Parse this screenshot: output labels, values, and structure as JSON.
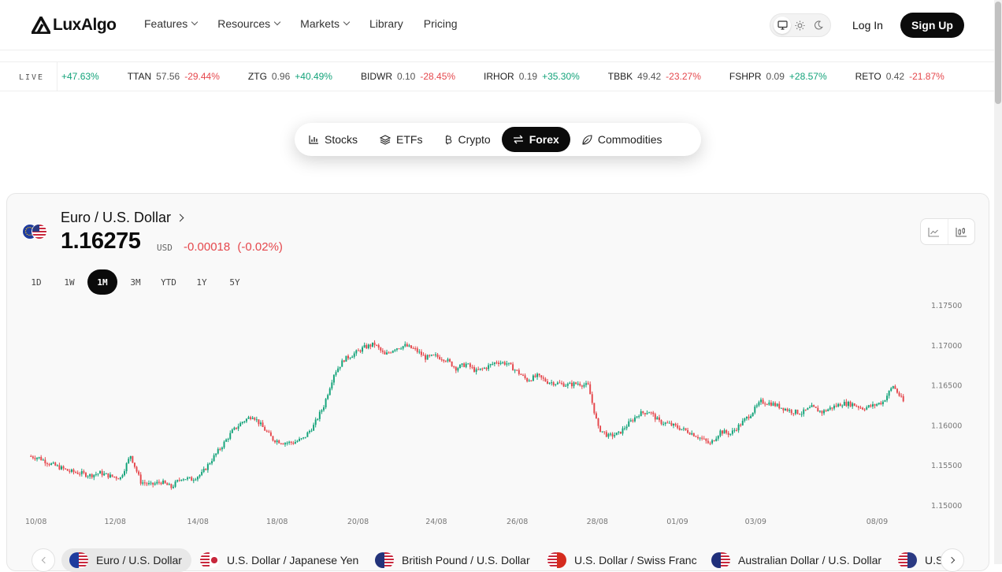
{
  "brand": {
    "name": "LuxAlgo"
  },
  "nav": {
    "links": [
      {
        "label": "Features",
        "dropdown": true
      },
      {
        "label": "Resources",
        "dropdown": true
      },
      {
        "label": "Markets",
        "dropdown": true
      },
      {
        "label": "Library",
        "dropdown": false
      },
      {
        "label": "Pricing",
        "dropdown": false
      }
    ],
    "login_label": "Log In",
    "signup_label": "Sign Up",
    "theme_options": [
      "monitor-icon",
      "sun-icon",
      "moon-icon"
    ]
  },
  "ticker": {
    "live_label": "LIVE",
    "items": [
      {
        "symbol": "",
        "price": "",
        "change": "+47.63%",
        "direction": "up"
      },
      {
        "symbol": "TTAN",
        "price": "57.56",
        "change": "-29.44%",
        "direction": "down"
      },
      {
        "symbol": "ZTG",
        "price": "0.96",
        "change": "+40.49%",
        "direction": "up"
      },
      {
        "symbol": "BIDWR",
        "price": "0.10",
        "change": "-28.45%",
        "direction": "down"
      },
      {
        "symbol": "IRHOR",
        "price": "0.19",
        "change": "+35.30%",
        "direction": "up"
      },
      {
        "symbol": "TBBK",
        "price": "49.42",
        "change": "-23.27%",
        "direction": "down"
      },
      {
        "symbol": "FSHPR",
        "price": "0.09",
        "change": "+28.57%",
        "direction": "up"
      },
      {
        "symbol": "RETO",
        "price": "0.42",
        "change": "-21.87%",
        "direction": "down"
      }
    ]
  },
  "market_tabs": [
    {
      "label": "Stocks",
      "icon": "bar-chart-icon",
      "active": false
    },
    {
      "label": "ETFs",
      "icon": "layers-icon",
      "active": false
    },
    {
      "label": "Crypto",
      "icon": "bitcoin-icon",
      "active": false
    },
    {
      "label": "Forex",
      "icon": "arrows-exchange-icon",
      "active": true
    },
    {
      "label": "Commodities",
      "icon": "leaf-icon",
      "active": false
    }
  ],
  "instrument": {
    "name": "Euro / U.S. Dollar",
    "price": "1.16275",
    "currency": "USD",
    "change": "-0.00018",
    "change_pct": "(-0.02%)"
  },
  "ranges": [
    {
      "label": "1D",
      "active": false
    },
    {
      "label": "1W",
      "active": false
    },
    {
      "label": "1M",
      "active": true
    },
    {
      "label": "3M",
      "active": false
    },
    {
      "label": "YTD",
      "active": false
    },
    {
      "label": "1Y",
      "active": false
    },
    {
      "label": "5Y",
      "active": false
    }
  ],
  "colors": {
    "up": "#13a37a",
    "down": "#e5484d",
    "accent": "#0b0b0b"
  },
  "chart_data": {
    "type": "candlestick",
    "title": "",
    "xlabel": "",
    "ylabel": "",
    "x_ticks": [
      "10/08",
      "12/08",
      "14/08",
      "18/08",
      "20/08",
      "24/08",
      "26/08",
      "28/08",
      "01/09",
      "03/09",
      "08/09"
    ],
    "y_ticks": [
      "1.17500",
      "1.17000",
      "1.16500",
      "1.16000",
      "1.15500",
      "1.15000"
    ],
    "ylim": [
      1.15,
      1.175
    ],
    "grid": false,
    "close_path": [
      1.1562,
      1.156,
      1.1553,
      1.1548,
      1.1543,
      1.1541,
      1.1538,
      1.1541,
      1.1537,
      1.1535,
      1.1563,
      1.153,
      1.1526,
      1.153,
      1.1523,
      1.1535,
      1.1533,
      1.154,
      1.1558,
      1.1575,
      1.1593,
      1.1605,
      1.1613,
      1.1598,
      1.1583,
      1.1579,
      1.1579,
      1.1584,
      1.16,
      1.1625,
      1.1665,
      1.1683,
      1.169,
      1.1698,
      1.1702,
      1.1688,
      1.1697,
      1.17,
      1.1695,
      1.1685,
      1.1687,
      1.1683,
      1.1672,
      1.1677,
      1.1668,
      1.1673,
      1.168,
      1.1678,
      1.1668,
      1.1657,
      1.1662,
      1.1655,
      1.1653,
      1.1651,
      1.1653,
      1.165,
      1.1597,
      1.1587,
      1.159,
      1.1603,
      1.1615,
      1.1618,
      1.1605,
      1.1602,
      1.1597,
      1.1592,
      1.1585,
      1.1577,
      1.1593,
      1.159,
      1.1602,
      1.1615,
      1.163,
      1.1628,
      1.1623,
      1.1618,
      1.1616,
      1.1623,
      1.1617,
      1.1623,
      1.1628,
      1.1627,
      1.1622,
      1.1625,
      1.163,
      1.165,
      1.163
    ]
  },
  "pair_selector": {
    "items": [
      {
        "label": "Euro / U.S. Dollar",
        "active": true,
        "flag": "eu-us-flag"
      },
      {
        "label": "U.S. Dollar / Japanese Yen",
        "active": false,
        "flag": "us-jp-flag"
      },
      {
        "label": "British Pound / U.S. Dollar",
        "active": false,
        "flag": "gb-us-flag"
      },
      {
        "label": "U.S. Dollar / Swiss Franc",
        "active": false,
        "flag": "us-ch-flag"
      },
      {
        "label": "Australian Dollar / U.S. Dollar",
        "active": false,
        "flag": "au-us-flag"
      },
      {
        "label": "U.S",
        "active": false,
        "flag": "us-flag"
      }
    ]
  }
}
